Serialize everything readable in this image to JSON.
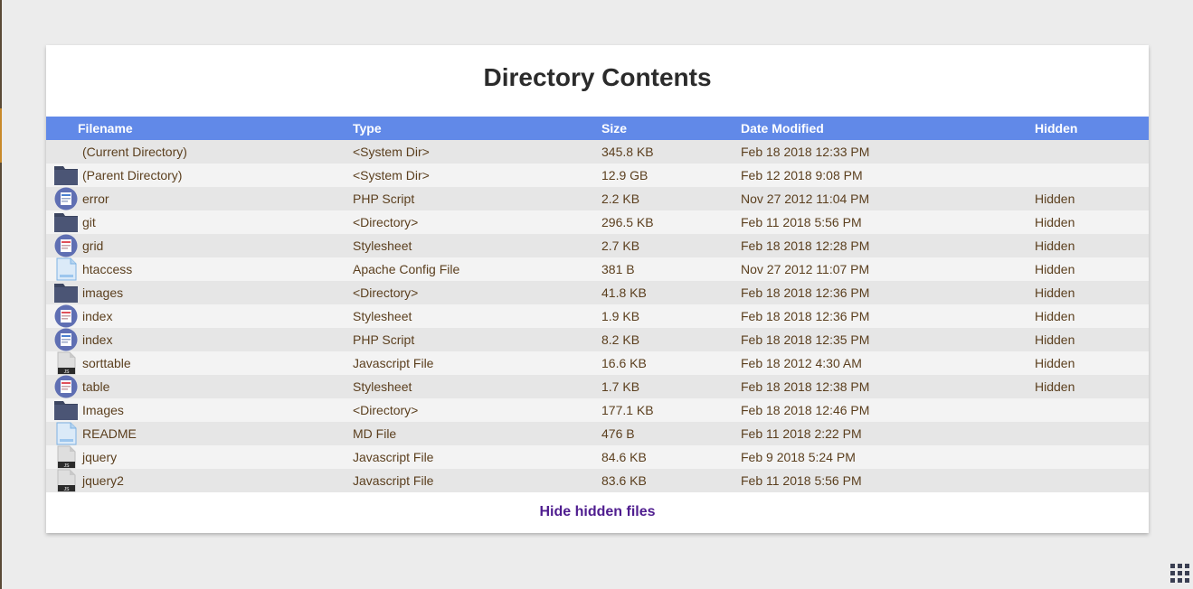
{
  "page": {
    "title": "Directory Contents"
  },
  "table": {
    "headers": [
      "Filename",
      "Type",
      "Size",
      "Date Modified",
      "Hidden"
    ],
    "rows": [
      {
        "icon": "none",
        "name": "(Current Directory)",
        "type": "<System Dir>",
        "size": "345.8 KB",
        "modified": "Feb 18 2018 12:33 PM",
        "hidden": ""
      },
      {
        "icon": "folder-icon",
        "name": "(Parent Directory)",
        "type": "<System Dir>",
        "size": "12.9 GB",
        "modified": "Feb 12 2018 9:08 PM",
        "hidden": ""
      },
      {
        "icon": "php-icon",
        "name": "error",
        "type": "PHP Script",
        "size": "2.2 KB",
        "modified": "Nov 27 2012 11:04 PM",
        "hidden": "Hidden"
      },
      {
        "icon": "folder-icon",
        "name": "git",
        "type": "<Directory>",
        "size": "296.5 KB",
        "modified": "Feb 11 2018 5:56 PM",
        "hidden": "Hidden"
      },
      {
        "icon": "css-icon",
        "name": "grid",
        "type": "Stylesheet",
        "size": "2.7 KB",
        "modified": "Feb 18 2018 12:28 PM",
        "hidden": "Hidden"
      },
      {
        "icon": "document-icon",
        "name": "htaccess",
        "type": "Apache Config File",
        "size": "381 B",
        "modified": "Nov 27 2012 11:07 PM",
        "hidden": "Hidden"
      },
      {
        "icon": "folder-icon",
        "name": "images",
        "type": "<Directory>",
        "size": "41.8 KB",
        "modified": "Feb 18 2018 12:36 PM",
        "hidden": "Hidden"
      },
      {
        "icon": "css-icon",
        "name": "index",
        "type": "Stylesheet",
        "size": "1.9 KB",
        "modified": "Feb 18 2018 12:36 PM",
        "hidden": "Hidden"
      },
      {
        "icon": "php-icon",
        "name": "index",
        "type": "PHP Script",
        "size": "8.2 KB",
        "modified": "Feb 18 2018 12:35 PM",
        "hidden": "Hidden"
      },
      {
        "icon": "js-icon",
        "name": "sorttable",
        "type": "Javascript File",
        "size": "16.6 KB",
        "modified": "Feb 18 2012 4:30 AM",
        "hidden": "Hidden"
      },
      {
        "icon": "css-icon",
        "name": "table",
        "type": "Stylesheet",
        "size": "1.7 KB",
        "modified": "Feb 18 2018 12:38 PM",
        "hidden": "Hidden"
      },
      {
        "icon": "folder-icon",
        "name": "Images",
        "type": "<Directory>",
        "size": "177.1 KB",
        "modified": "Feb 18 2018 12:46 PM",
        "hidden": ""
      },
      {
        "icon": "document-icon",
        "name": "README",
        "type": "MD File",
        "size": "476 B",
        "modified": "Feb 11 2018 2:22 PM",
        "hidden": ""
      },
      {
        "icon": "js-icon",
        "name": "jquery",
        "type": "Javascript File",
        "size": "84.6 KB",
        "modified": "Feb 9 2018 5:24 PM",
        "hidden": ""
      },
      {
        "icon": "js-icon",
        "name": "jquery2",
        "type": "Javascript File",
        "size": "83.6 KB",
        "modified": "Feb 11 2018 5:56 PM",
        "hidden": ""
      }
    ]
  },
  "footer": {
    "toggle_label": "Hide hidden files"
  },
  "colors": {
    "header_bg": "#6189e8",
    "row_odd": "#e6e6e6",
    "row_even": "#f3f3f3",
    "text": "#5b3f1e",
    "link": "#4f1d8f"
  },
  "corner": {
    "icon": "apps-grid-icon"
  }
}
